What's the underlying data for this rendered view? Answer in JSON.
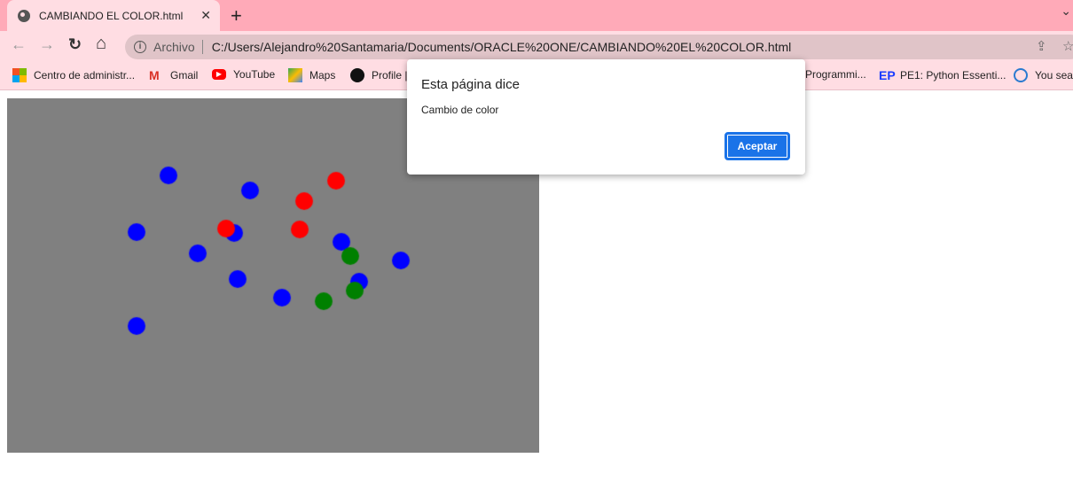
{
  "tab": {
    "title": "CAMBIANDO EL COLOR.html",
    "close": "✕",
    "new_tab": "+"
  },
  "toolbar": {
    "back": "←",
    "forward": "→",
    "reload": "↻",
    "home": "⌂",
    "scheme": "Archivo",
    "url": "C:/Users/Alejandro%20Santamaria/Documents/ORACLE%20ONE/CAMBIANDO%20EL%20COLOR.html",
    "share": "⇪",
    "star": "☆"
  },
  "bookmarks": [
    {
      "label": "Centro de administr...",
      "icon": "microsoft-icon"
    },
    {
      "label": "Gmail",
      "icon": "gmail-icon"
    },
    {
      "label": "YouTube",
      "icon": "youtube-icon"
    },
    {
      "label": "Maps",
      "icon": "maps-icon"
    },
    {
      "label": "Profile |",
      "icon": "profile-icon"
    },
    {
      "label": "Programmi...",
      "icon": ""
    },
    {
      "label": "PE1: Python Essenti...",
      "icon": "ep-icon"
    },
    {
      "label": "You sear",
      "icon": "it-icon"
    }
  ],
  "dialog": {
    "title": "Esta página dice",
    "message": "Cambio de color",
    "ok_label": "Aceptar"
  },
  "canvas": {
    "background": "#808080",
    "colors": {
      "blue": "#0000ff",
      "red": "#ff0000",
      "green": "#008000"
    },
    "counts": {
      "blue": 11,
      "red": 4,
      "green": 3
    }
  }
}
